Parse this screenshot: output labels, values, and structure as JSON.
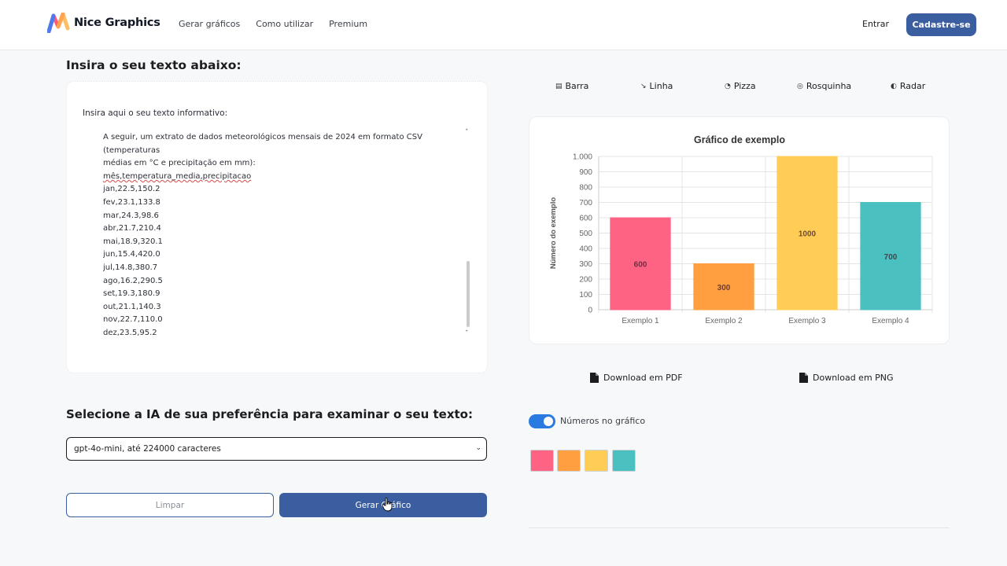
{
  "header": {
    "brand": "Nice Graphics",
    "nav": [
      "Gerar gráficos",
      "Como utilizar",
      "Premium"
    ],
    "login": "Entrar",
    "signup": "Cadastre-se"
  },
  "input_section": {
    "title": "Insira o seu texto abaixo:",
    "card_label": "Insira aqui o seu texto informativo:",
    "text_lines": [
      "A seguir, um extrato de dados meteorológicos mensais de 2024 em formato CSV",
      "(temperaturas",
      "médias em °C e precipitação em mm):",
      "mês,temperatura_media,precipitacao",
      "jan,22.5,150.2",
      "fev,23.1,133.8",
      "mar,24.3,98.6",
      "abr,21.7,210.4",
      "mai,18.9,320.1",
      "jun,15.4,420.0",
      "jul,14.8,380.7",
      "ago,16.2,290.5",
      "set,19.3,180.9",
      "out,21.1,140.3",
      "nov,22.7,110.0",
      "dez,23.5,95.2"
    ]
  },
  "ai_section": {
    "title": "Selecione a IA de sua preferência para examinar o seu texto:",
    "selected": "gpt-4o-mini, até 224000 caracteres"
  },
  "actions": {
    "clear": "Limpar",
    "generate": "Gerar Gráfico"
  },
  "chart_tabs": [
    {
      "label": "Barra",
      "icon": "bar-chart-icon"
    },
    {
      "label": "Linha",
      "icon": "line-chart-icon"
    },
    {
      "label": "Pizza",
      "icon": "pie-chart-icon"
    },
    {
      "label": "Rosquinha",
      "icon": "donut-chart-icon"
    },
    {
      "label": "Radar",
      "icon": "radar-chart-icon"
    }
  ],
  "chart_data": {
    "type": "bar",
    "title": "Gráfico de exemplo",
    "xlabel": "",
    "ylabel": "Número do exemplo",
    "categories": [
      "Exemplo 1",
      "Exemplo 2",
      "Exemplo 3",
      "Exemplo 4"
    ],
    "values": [
      600,
      300,
      1000,
      700
    ],
    "value_labels": [
      "600",
      "300",
      "1000",
      "700"
    ],
    "colors": [
      "#ff6384",
      "#ff9f40",
      "#ffcd56",
      "#4bc0c0"
    ],
    "ylim": [
      0,
      1000
    ],
    "yticks": [
      0,
      100,
      200,
      300,
      400,
      500,
      600,
      700,
      800,
      900,
      1000
    ],
    "ytick_labels": [
      "0",
      "100",
      "200",
      "300",
      "400",
      "500",
      "600",
      "700",
      "800",
      "900",
      "1.000"
    ],
    "grid": true
  },
  "downloads": {
    "pdf": "Download em PDF",
    "png": "Download em PNG"
  },
  "options": {
    "numbers_toggle_label": "Números no gráfico",
    "numbers_toggle_on": true,
    "swatches": [
      "#ff6384",
      "#ff9f40",
      "#ffcd56",
      "#4bc0c0"
    ]
  }
}
